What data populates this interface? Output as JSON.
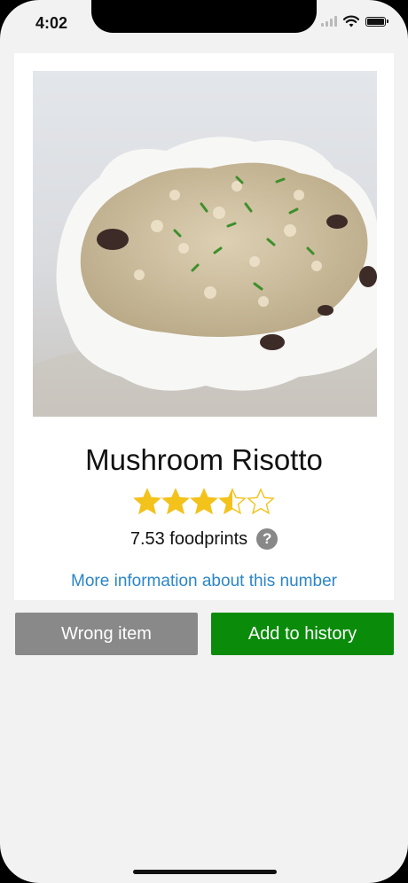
{
  "status_bar": {
    "time": "4:02",
    "icons": [
      "cellular-signal-icon",
      "wifi-icon",
      "battery-icon"
    ]
  },
  "dish": {
    "name": "Mushroom Risotto",
    "rating": 3.5,
    "rating_max": 5,
    "footprint_label": "7.53 foodprints",
    "help_symbol": "?",
    "info_link": "More information about this number",
    "image_description_icon": "risotto-photo"
  },
  "actions": {
    "wrong_item": "Wrong item",
    "add_history": "Add to history"
  },
  "colors": {
    "star": "#f3c21b",
    "add_button": "#0a8c0a",
    "wrong_button": "#898989",
    "link": "#2a86c9"
  }
}
